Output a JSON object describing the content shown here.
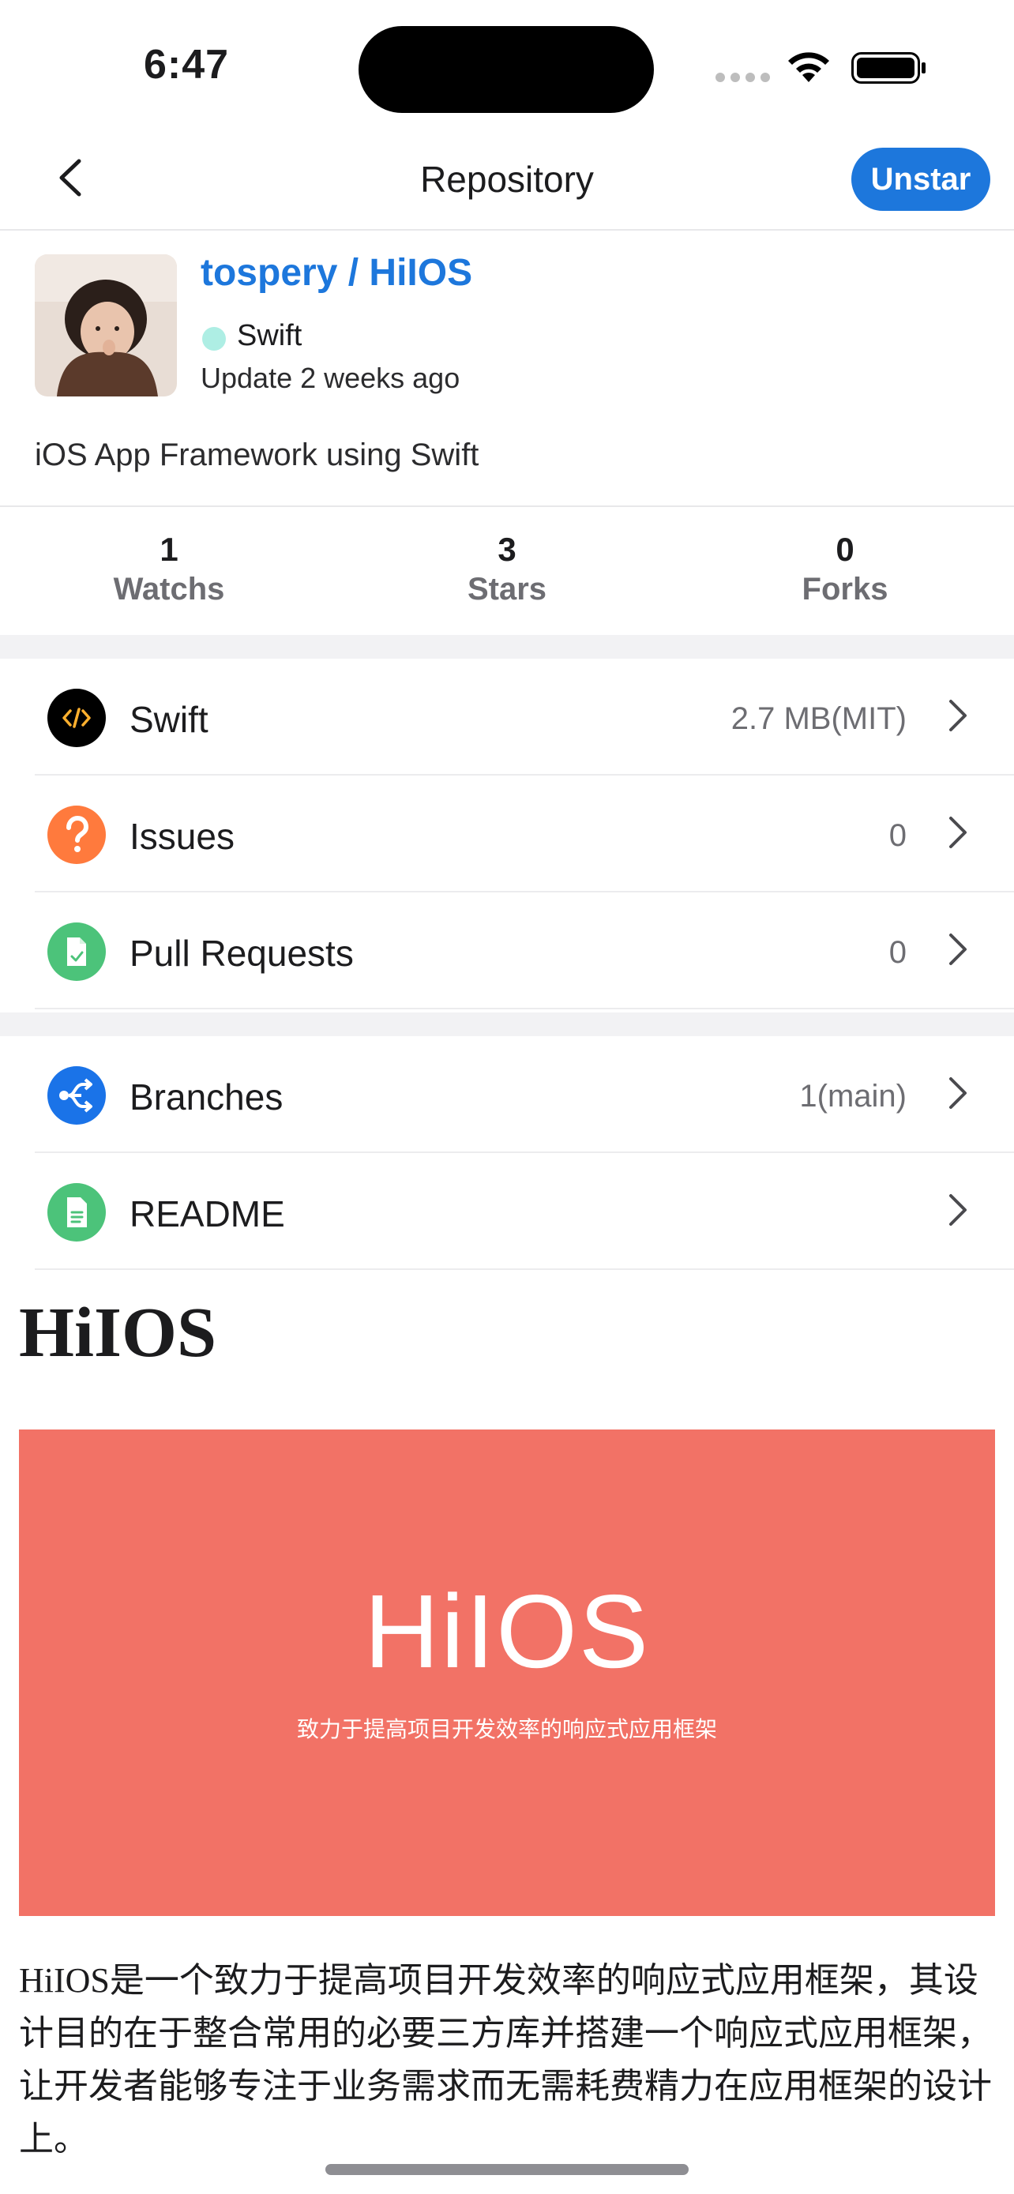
{
  "status_bar": {
    "time": "6:47"
  },
  "nav": {
    "title": "Repository",
    "unstar_label": "Unstar"
  },
  "repo": {
    "full_name": "tospery / HiIOS",
    "language": "Swift",
    "updated": "Update 2 weeks ago",
    "description": "iOS App Framework using Swift"
  },
  "stats": [
    {
      "value": "1",
      "label": "Watchs"
    },
    {
      "value": "3",
      "label": "Stars"
    },
    {
      "value": "0",
      "label": "Forks"
    }
  ],
  "rows": [
    {
      "label": "Swift",
      "value": "2.7 MB(MIT)",
      "icon": "code-icon",
      "color": "#000000"
    },
    {
      "label": "Issues",
      "value": "0",
      "icon": "question-icon",
      "color": "#ff7a3d"
    },
    {
      "label": "Pull Requests",
      "value": "0",
      "icon": "pull-request-icon",
      "color": "#4cc37a"
    },
    {
      "label": "Branches",
      "value": "1(main)",
      "icon": "branch-icon",
      "color": "#1a73e8"
    },
    {
      "label": "README",
      "value": "",
      "icon": "document-icon",
      "color": "#4cc37a"
    }
  ],
  "readme": {
    "title": "HiIOS",
    "banner_title": "HiIOS",
    "banner_subtitle": "致力于提高项目开发效率的响应式应用框架",
    "banner_color": "#f27266",
    "body": "HiIOS是一个致力于提高项目开发效率的响应式应用框架，其设计目的在于整合常用的必要三方库并搭建一个响应式应用框架，让开发者能够专注于业务需求而无需耗费精力在应用框架的设计上。"
  },
  "colors": {
    "accent": "#1d77dc",
    "language_dot": "#aeeee4"
  }
}
